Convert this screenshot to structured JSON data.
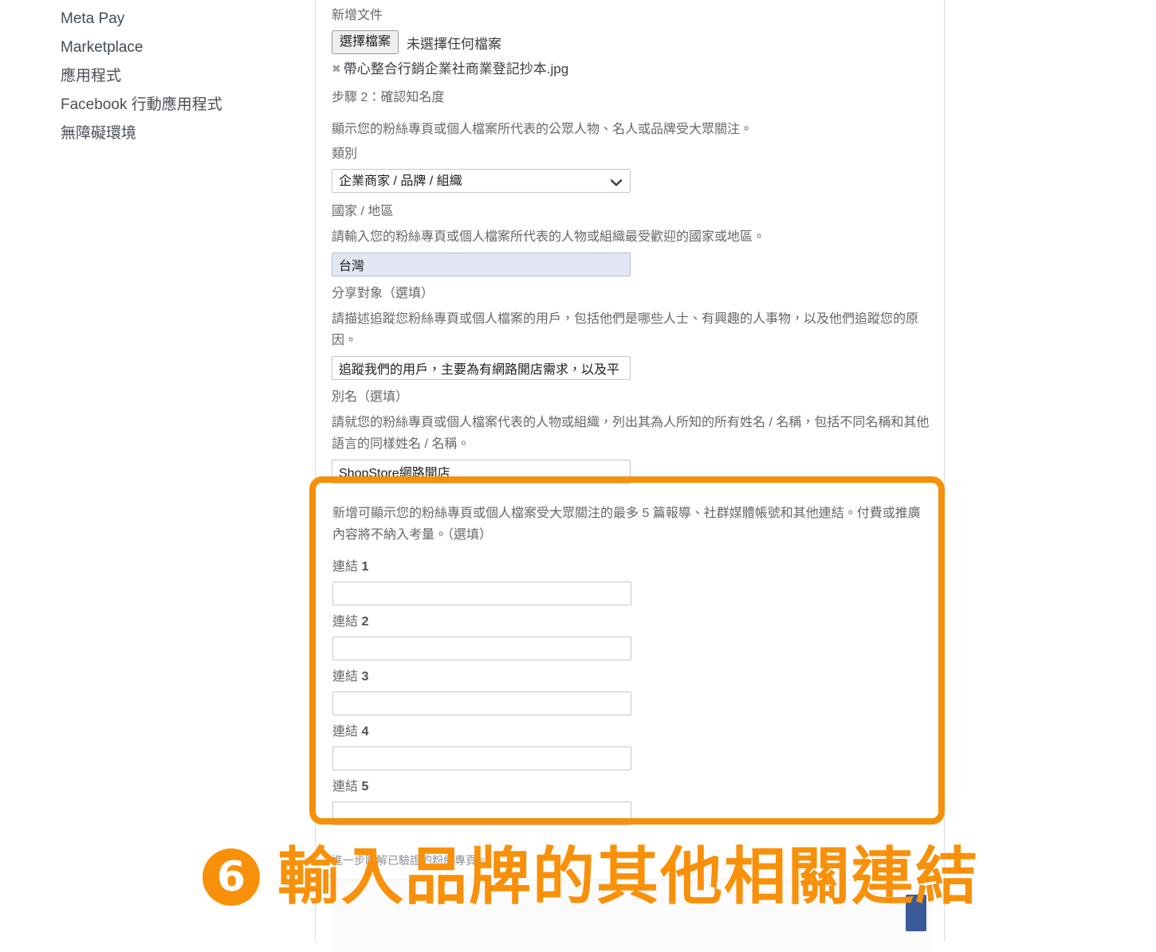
{
  "sidebar": {
    "items": [
      {
        "label": "Meta Pay",
        "latin": true
      },
      {
        "label": "Marketplace",
        "latin": true
      },
      {
        "label": "應用程式",
        "latin": false
      },
      {
        "label": "Facebook 行動應用程式",
        "latin": false
      },
      {
        "label": "無障礙環境",
        "latin": false
      }
    ]
  },
  "form": {
    "add_document_label": "新增文件",
    "file_button_label": "選擇檔案",
    "file_status": "未選擇任何檔案",
    "uploaded_file": "帶心整合行銷企業社商業登記抄本.jpg",
    "remove_icon": "✖",
    "step_heading": "步驟 2：確認知名度",
    "step_description": "顯示您的粉絲專頁或個人檔案所代表的公眾人物、名人或品牌受大眾關注。",
    "category": {
      "label": "類別",
      "selected": "企業商家 / 品牌 / 組織",
      "options": [
        "企業商家 / 品牌 / 組織"
      ]
    },
    "country": {
      "label": "國家 / 地區",
      "description": "請輸入您的粉絲專頁或個人檔案所代表的人物或組織最受歡迎的國家或地區。",
      "value": "台灣",
      "placeholder": ""
    },
    "audience": {
      "label": "分享對象（選填）",
      "description": "請描述追蹤您粉絲專頁或個人檔案的用戶，包括他們是哪些人士、有興趣的人事物，以及他們追蹤您的原因。",
      "value": "追蹤我們的用戶，主要為有網路開店需求，以及平",
      "placeholder": ""
    },
    "aka": {
      "label": "別名（選填）",
      "description": "請就您的粉絲專頁或個人檔案代表的人物或組織，列出其為人所知的所有姓名 / 名稱，包括不同名稱和其他語言的同樣姓名 / 名稱。",
      "value": "ShopStore網路開店",
      "placeholder": ""
    },
    "links": {
      "description": "新增可顯示您的粉絲專頁或個人檔案受大眾關注的最多 5 篇報導、社群媒體帳號和其他連結。付費或推廣內容將不納入考量。（選填）",
      "fields": [
        {
          "label_prefix": "連結 ",
          "index": "1",
          "value": "",
          "placeholder": ""
        },
        {
          "label_prefix": "連結 ",
          "index": "2",
          "value": "",
          "placeholder": ""
        },
        {
          "label_prefix": "連結 ",
          "index": "3",
          "value": "",
          "placeholder": ""
        },
        {
          "label_prefix": "連結 ",
          "index": "4",
          "value": "",
          "placeholder": ""
        },
        {
          "label_prefix": "連結 ",
          "index": "5",
          "value": "",
          "placeholder": ""
        }
      ]
    },
    "footer_note": "進一步瞭解已驗證的粉絲專頁。"
  },
  "annotation": {
    "number": "6",
    "text": "輸入品牌的其他相關連結",
    "color": "#f99009"
  }
}
